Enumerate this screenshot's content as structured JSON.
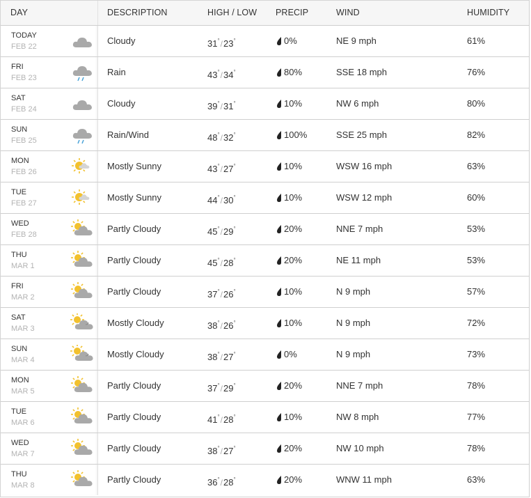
{
  "header": {
    "day": "DAY",
    "description": "DESCRIPTION",
    "high_low": "HIGH / LOW",
    "precip": "PRECIP",
    "wind": "WIND",
    "humidity": "HUMIDITY"
  },
  "rows": [
    {
      "day": "TODAY",
      "date": "FEB 22",
      "icon": "cloudy-icon",
      "desc": "Cloudy",
      "hi": "31",
      "lo": "23",
      "precip": "0%",
      "wind": "NE 9 mph",
      "humidity": "61%"
    },
    {
      "day": "FRI",
      "date": "FEB 23",
      "icon": "rain-icon",
      "desc": "Rain",
      "hi": "43",
      "lo": "34",
      "precip": "80%",
      "wind": "SSE 18 mph",
      "humidity": "76%"
    },
    {
      "day": "SAT",
      "date": "FEB 24",
      "icon": "cloudy-icon",
      "desc": "Cloudy",
      "hi": "39",
      "lo": "31",
      "precip": "10%",
      "wind": "NW 6 mph",
      "humidity": "80%"
    },
    {
      "day": "SUN",
      "date": "FEB 25",
      "icon": "rain-icon",
      "desc": "Rain/Wind",
      "hi": "48",
      "lo": "32",
      "precip": "100%",
      "wind": "SSE 25 mph",
      "humidity": "82%"
    },
    {
      "day": "MON",
      "date": "FEB 26",
      "icon": "mostly-sunny-icon",
      "desc": "Mostly Sunny",
      "hi": "43",
      "lo": "27",
      "precip": "10%",
      "wind": "WSW 16 mph",
      "humidity": "63%"
    },
    {
      "day": "TUE",
      "date": "FEB 27",
      "icon": "mostly-sunny-icon",
      "desc": "Mostly Sunny",
      "hi": "44",
      "lo": "30",
      "precip": "10%",
      "wind": "WSW 12 mph",
      "humidity": "60%"
    },
    {
      "day": "WED",
      "date": "FEB 28",
      "icon": "partly-cloudy-icon",
      "desc": "Partly Cloudy",
      "hi": "45",
      "lo": "29",
      "precip": "20%",
      "wind": "NNE 7 mph",
      "humidity": "53%"
    },
    {
      "day": "THU",
      "date": "MAR 1",
      "icon": "partly-cloudy-icon",
      "desc": "Partly Cloudy",
      "hi": "45",
      "lo": "28",
      "precip": "20%",
      "wind": "NE 11 mph",
      "humidity": "53%"
    },
    {
      "day": "FRI",
      "date": "MAR 2",
      "icon": "partly-cloudy-icon",
      "desc": "Partly Cloudy",
      "hi": "37",
      "lo": "26",
      "precip": "10%",
      "wind": "N 9 mph",
      "humidity": "57%"
    },
    {
      "day": "SAT",
      "date": "MAR 3",
      "icon": "mostly-cloudy-icon",
      "desc": "Mostly Cloudy",
      "hi": "38",
      "lo": "26",
      "precip": "10%",
      "wind": "N 9 mph",
      "humidity": "72%"
    },
    {
      "day": "SUN",
      "date": "MAR 4",
      "icon": "mostly-cloudy-icon",
      "desc": "Mostly Cloudy",
      "hi": "38",
      "lo": "27",
      "precip": "0%",
      "wind": "N 9 mph",
      "humidity": "73%"
    },
    {
      "day": "MON",
      "date": "MAR 5",
      "icon": "partly-cloudy-icon",
      "desc": "Partly Cloudy",
      "hi": "37",
      "lo": "29",
      "precip": "20%",
      "wind": "NNE 7 mph",
      "humidity": "78%"
    },
    {
      "day": "TUE",
      "date": "MAR 6",
      "icon": "partly-cloudy-icon",
      "desc": "Partly Cloudy",
      "hi": "41",
      "lo": "28",
      "precip": "10%",
      "wind": "NW 8 mph",
      "humidity": "77%"
    },
    {
      "day": "WED",
      "date": "MAR 7",
      "icon": "partly-cloudy-icon",
      "desc": "Partly Cloudy",
      "hi": "38",
      "lo": "27",
      "precip": "20%",
      "wind": "NW 10 mph",
      "humidity": "78%"
    },
    {
      "day": "THU",
      "date": "MAR 8",
      "icon": "partly-cloudy-icon",
      "desc": "Partly Cloudy",
      "hi": "36",
      "lo": "28",
      "precip": "20%",
      "wind": "WNW 11 mph",
      "humidity": "63%"
    }
  ],
  "colors": {
    "cloud": "#a9a9a9",
    "sun": "#f2c12e",
    "rain": "#4aa3d8",
    "drop": "#222222",
    "date": "#b3b3b3"
  }
}
